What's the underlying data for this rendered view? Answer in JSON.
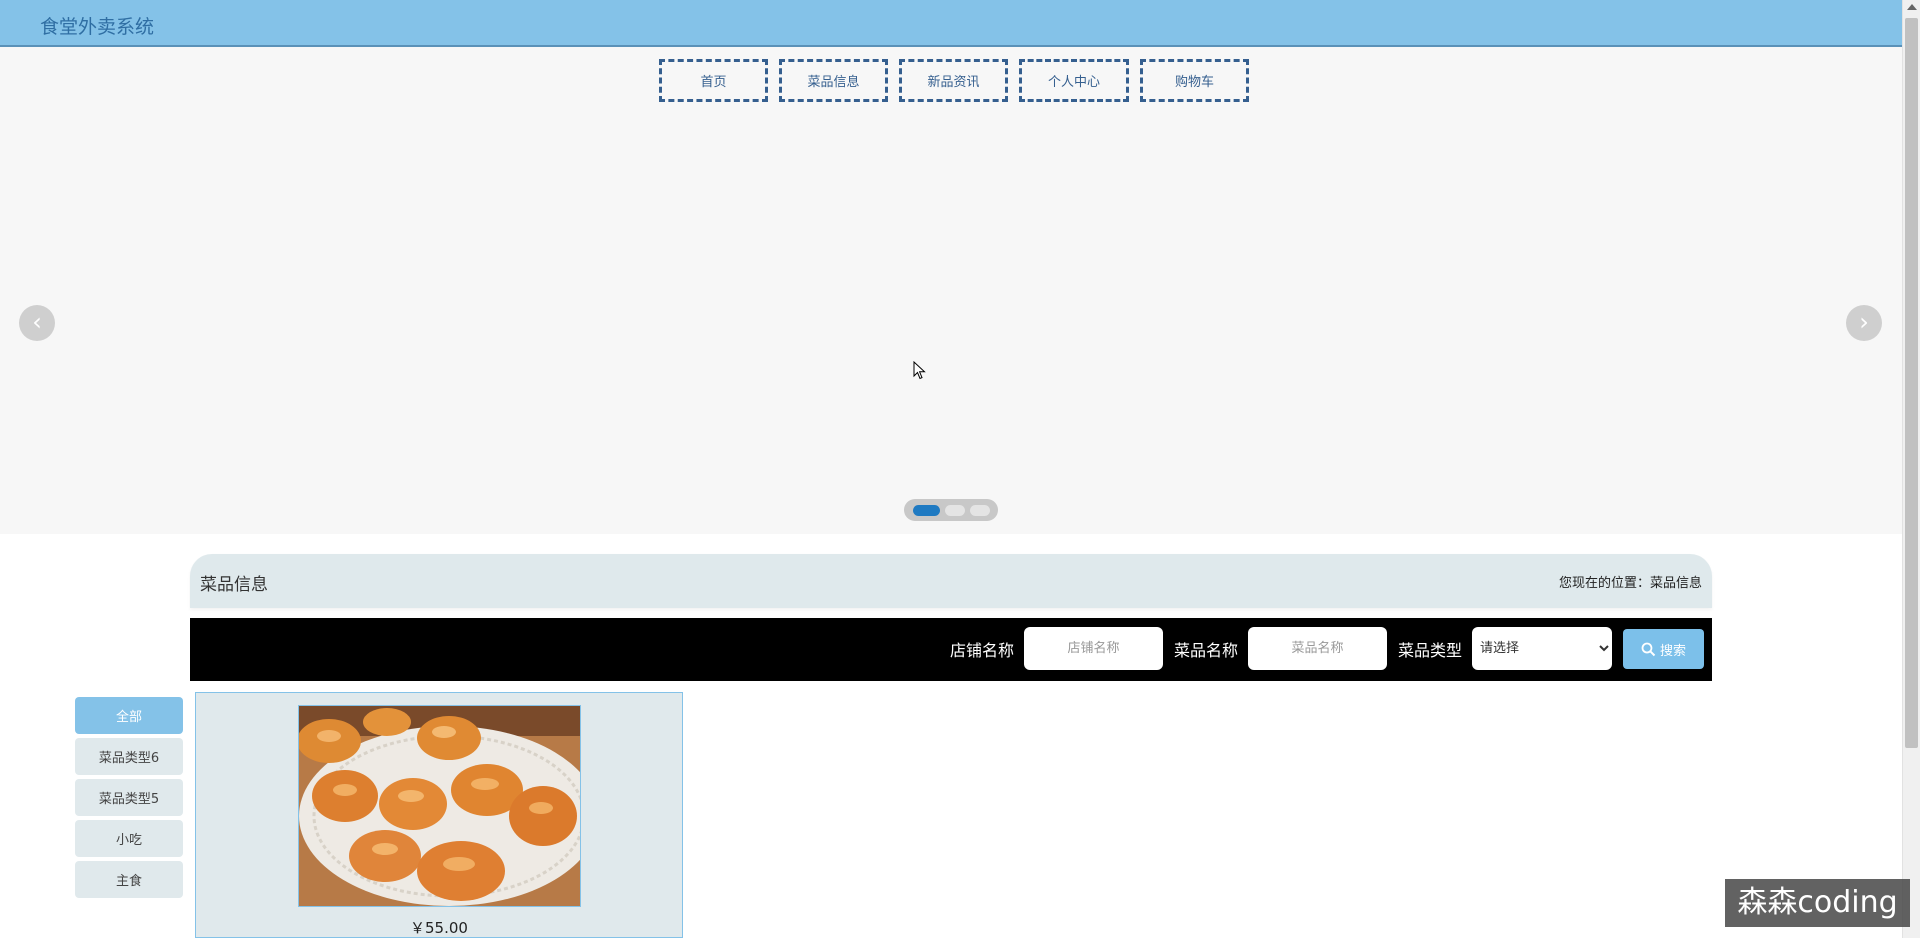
{
  "header": {
    "title": "食堂外卖系统"
  },
  "nav": {
    "items": [
      {
        "label": "首页"
      },
      {
        "label": "菜品信息"
      },
      {
        "label": "新品资讯"
      },
      {
        "label": "个人中心"
      },
      {
        "label": "购物车"
      }
    ]
  },
  "carousel": {
    "slide_count": 3,
    "active_slide": 1
  },
  "section": {
    "title": "菜品信息",
    "breadcrumb": "您现在的位置：菜品信息"
  },
  "search": {
    "shop_label": "店铺名称",
    "shop_placeholder": "店铺名称",
    "dish_label": "菜品名称",
    "dish_placeholder": "菜品名称",
    "type_label": "菜品类型",
    "type_selected": "请选择",
    "button_label": "搜索"
  },
  "categories": [
    {
      "label": "全部",
      "active": true
    },
    {
      "label": "菜品类型6"
    },
    {
      "label": "菜品类型5"
    },
    {
      "label": "小吃"
    },
    {
      "label": "主食"
    }
  ],
  "products": [
    {
      "price": "￥55.00",
      "image": "chicken-wings"
    }
  ],
  "watermark": "森森coding",
  "colors": {
    "header_bg": "#84c2e8",
    "nav_border": "#355f8f",
    "panel_bg": "#e0e9ec",
    "search_bar_bg": "#000000",
    "accent": "#84c2e8"
  }
}
